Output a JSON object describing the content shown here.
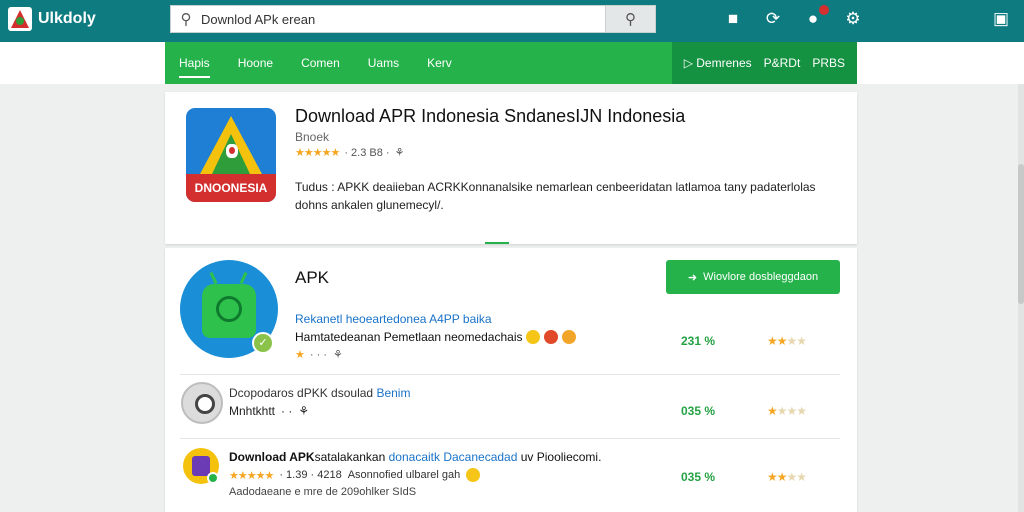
{
  "topbar": {
    "logo_text": "Ulkdoly",
    "search_placeholder": "Downlod APk erean",
    "search_value": "Downlod APk erean",
    "icons": [
      "puzzle-icon",
      "refresh-icon",
      "bell-icon",
      "settings-icon",
      "window-icon"
    ],
    "notification_dot": true
  },
  "nav": {
    "items": [
      "Hapis",
      "Hoone",
      "Comen",
      "Uams",
      "Kerv"
    ],
    "active": "Hapis",
    "right_items": [
      "Demrenes",
      "P&RDt",
      "PRBS"
    ]
  },
  "hero": {
    "title": "Download APR Indonesia SndanesIJN Indonesia",
    "icon_label": "DNOONESIA",
    "developer": "Bnoek",
    "stars": "★★★★★",
    "rating_text": "· 2.3 B8 ·",
    "description": "Tudus : APKK deaiieban ACRKKonnanalsike nemarlean cenbeeridatan latlamoa tany padaterlolas dohns ankalen glunemecyl/."
  },
  "list": {
    "section_title": "APK",
    "download_button": "Wiovlore dosbleggdaon",
    "rows": [
      {
        "link": "Rekanetl heoeartedonea A4PP baika",
        "text": "Hamtatedeanan Pemetlaan neomedachais",
        "meta": "· · ·",
        "percent": "231 %",
        "stars_on": 2,
        "stars_total": 4
      },
      {
        "title_prefix": "Dcopodaros dPKK dsoulad ",
        "title_link": "Benim",
        "meta_text": "Mnhtkhtt",
        "meta_dots": "· ·",
        "percent": "035 %",
        "stars_on": 1,
        "stars_total": 4
      },
      {
        "title_bold": "Download APK",
        "title_rest": "satalakankan ",
        "title_link": "donacaitk Dacanecadad",
        "title_tail": " uv Piooliecomi.",
        "stars": "★★★★★",
        "meta": "· 1.39 · 4218",
        "meta_tail": "Asonnofied ulbarel gah",
        "footer": "Aadodaeane e mre de 209ohlker SIdS",
        "percent": "035 %",
        "stars_on": 2,
        "stars_total": 4
      }
    ]
  },
  "colors": {
    "topbar": "#0e7b80",
    "nav": "#25b24a",
    "link": "#1a73c8",
    "star": "#f5a623"
  }
}
